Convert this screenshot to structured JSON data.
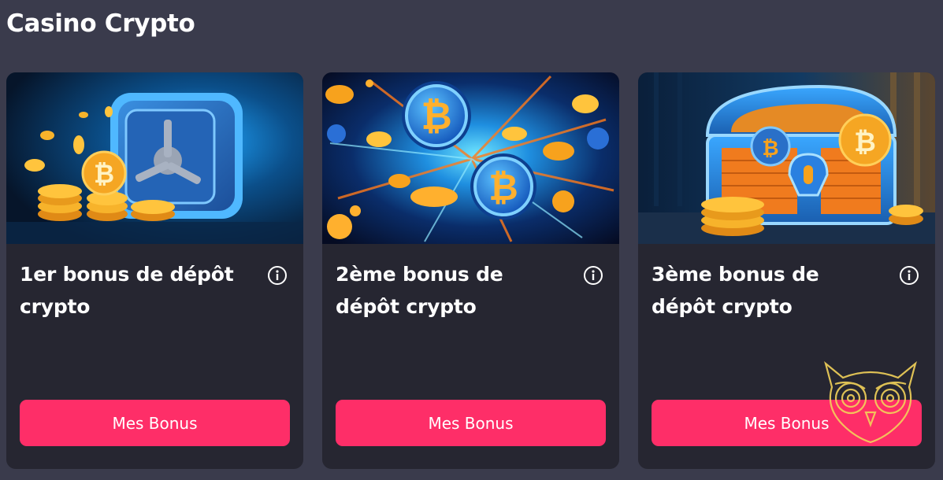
{
  "section": {
    "title": "Casino Crypto"
  },
  "cards": [
    {
      "title": "1er bonus de dépôt crypto",
      "button_label": "Mes Bonus",
      "image_icon": "safe-with-coins"
    },
    {
      "title": "2ème bonus de dépôt crypto",
      "button_label": "Mes Bonus",
      "image_icon": "bitcoin-burst"
    },
    {
      "title": "3ème bonus de dépôt crypto",
      "button_label": "Mes Bonus",
      "image_icon": "treasure-chest"
    }
  ],
  "colors": {
    "background": "#3a3b4c",
    "card": "#262631",
    "accent": "#fe2e68",
    "coin": "#f5a623",
    "watermark": "#f3d25a"
  }
}
